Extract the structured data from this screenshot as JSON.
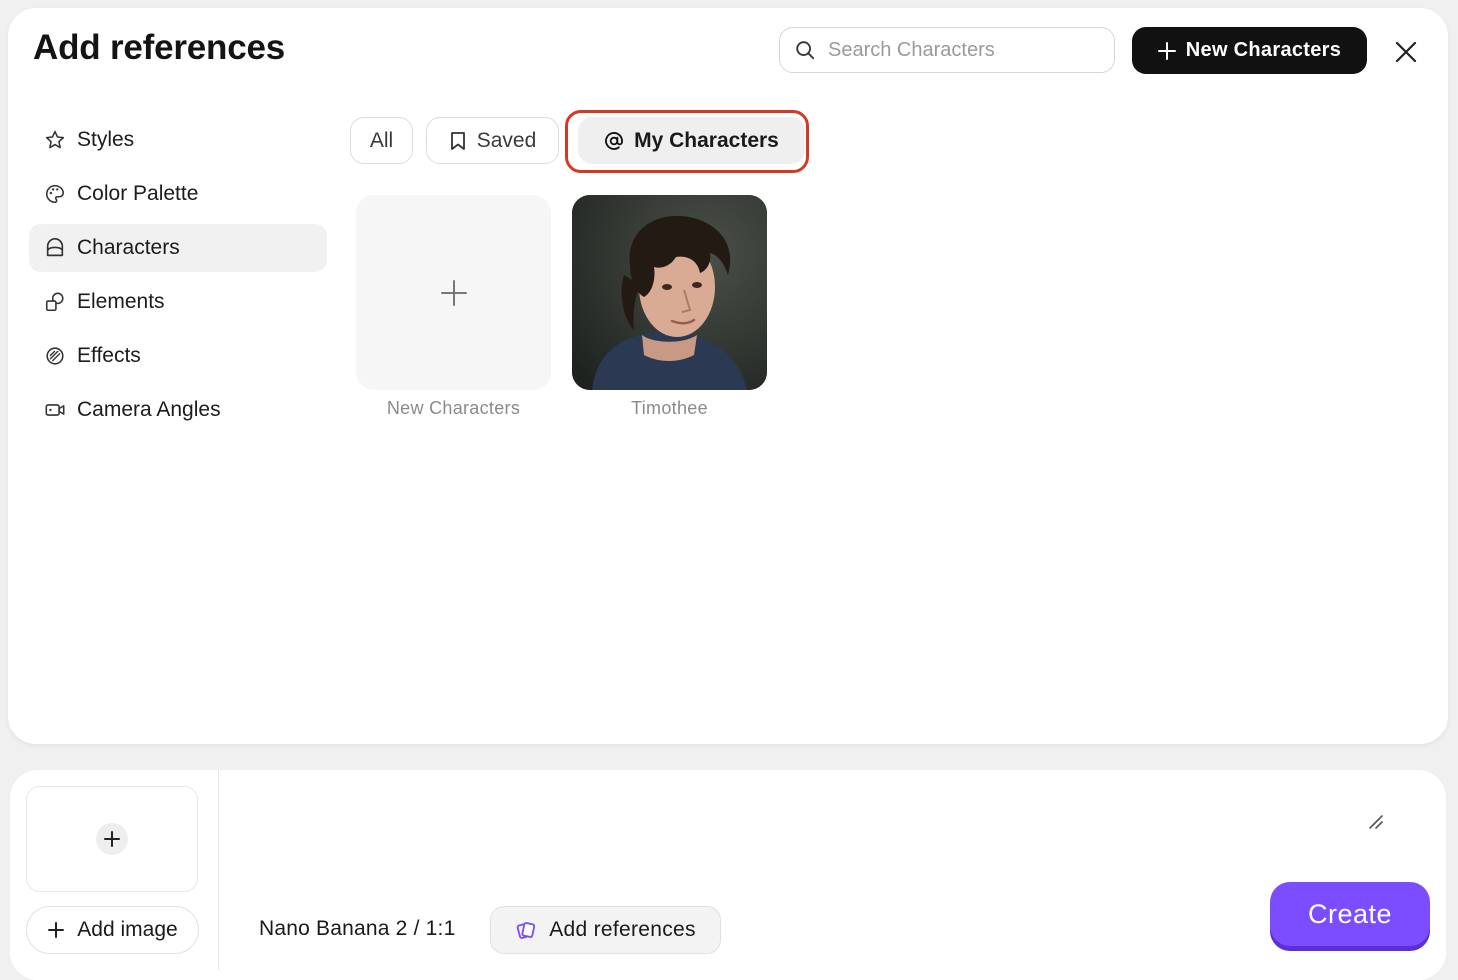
{
  "modal": {
    "title": "Add references",
    "search": {
      "placeholder": "Search Characters",
      "value": ""
    },
    "new_button_label": "New Characters",
    "close_icon": "close-icon"
  },
  "sidebar": {
    "items": [
      {
        "label": "Styles",
        "icon": "star-icon",
        "active": false
      },
      {
        "label": "Color Palette",
        "icon": "palette-icon",
        "active": false
      },
      {
        "label": "Characters",
        "icon": "character-icon",
        "active": true
      },
      {
        "label": "Elements",
        "icon": "shapes-icon",
        "active": false
      },
      {
        "label": "Effects",
        "icon": "effects-icon",
        "active": false
      },
      {
        "label": "Camera Angles",
        "icon": "camera-icon",
        "active": false
      }
    ]
  },
  "filters": {
    "items": [
      {
        "label": "All",
        "active": false
      },
      {
        "label": "Saved",
        "icon": "bookmark-icon",
        "active": false
      },
      {
        "label": "My Characters",
        "icon": "at-icon",
        "active": true
      }
    ]
  },
  "characters": {
    "items": [
      {
        "label": "New Characters",
        "kind": "add"
      },
      {
        "label": "Timothee",
        "kind": "photo"
      }
    ]
  },
  "composer": {
    "add_image_label": "Add image",
    "model_label": "Nano Banana 2 / 1:1",
    "add_references_label": "Add references",
    "create_label": "Create"
  },
  "colors": {
    "accent": "#7c4dff",
    "highlight": "#d23a25",
    "primary_button": "#111111"
  }
}
